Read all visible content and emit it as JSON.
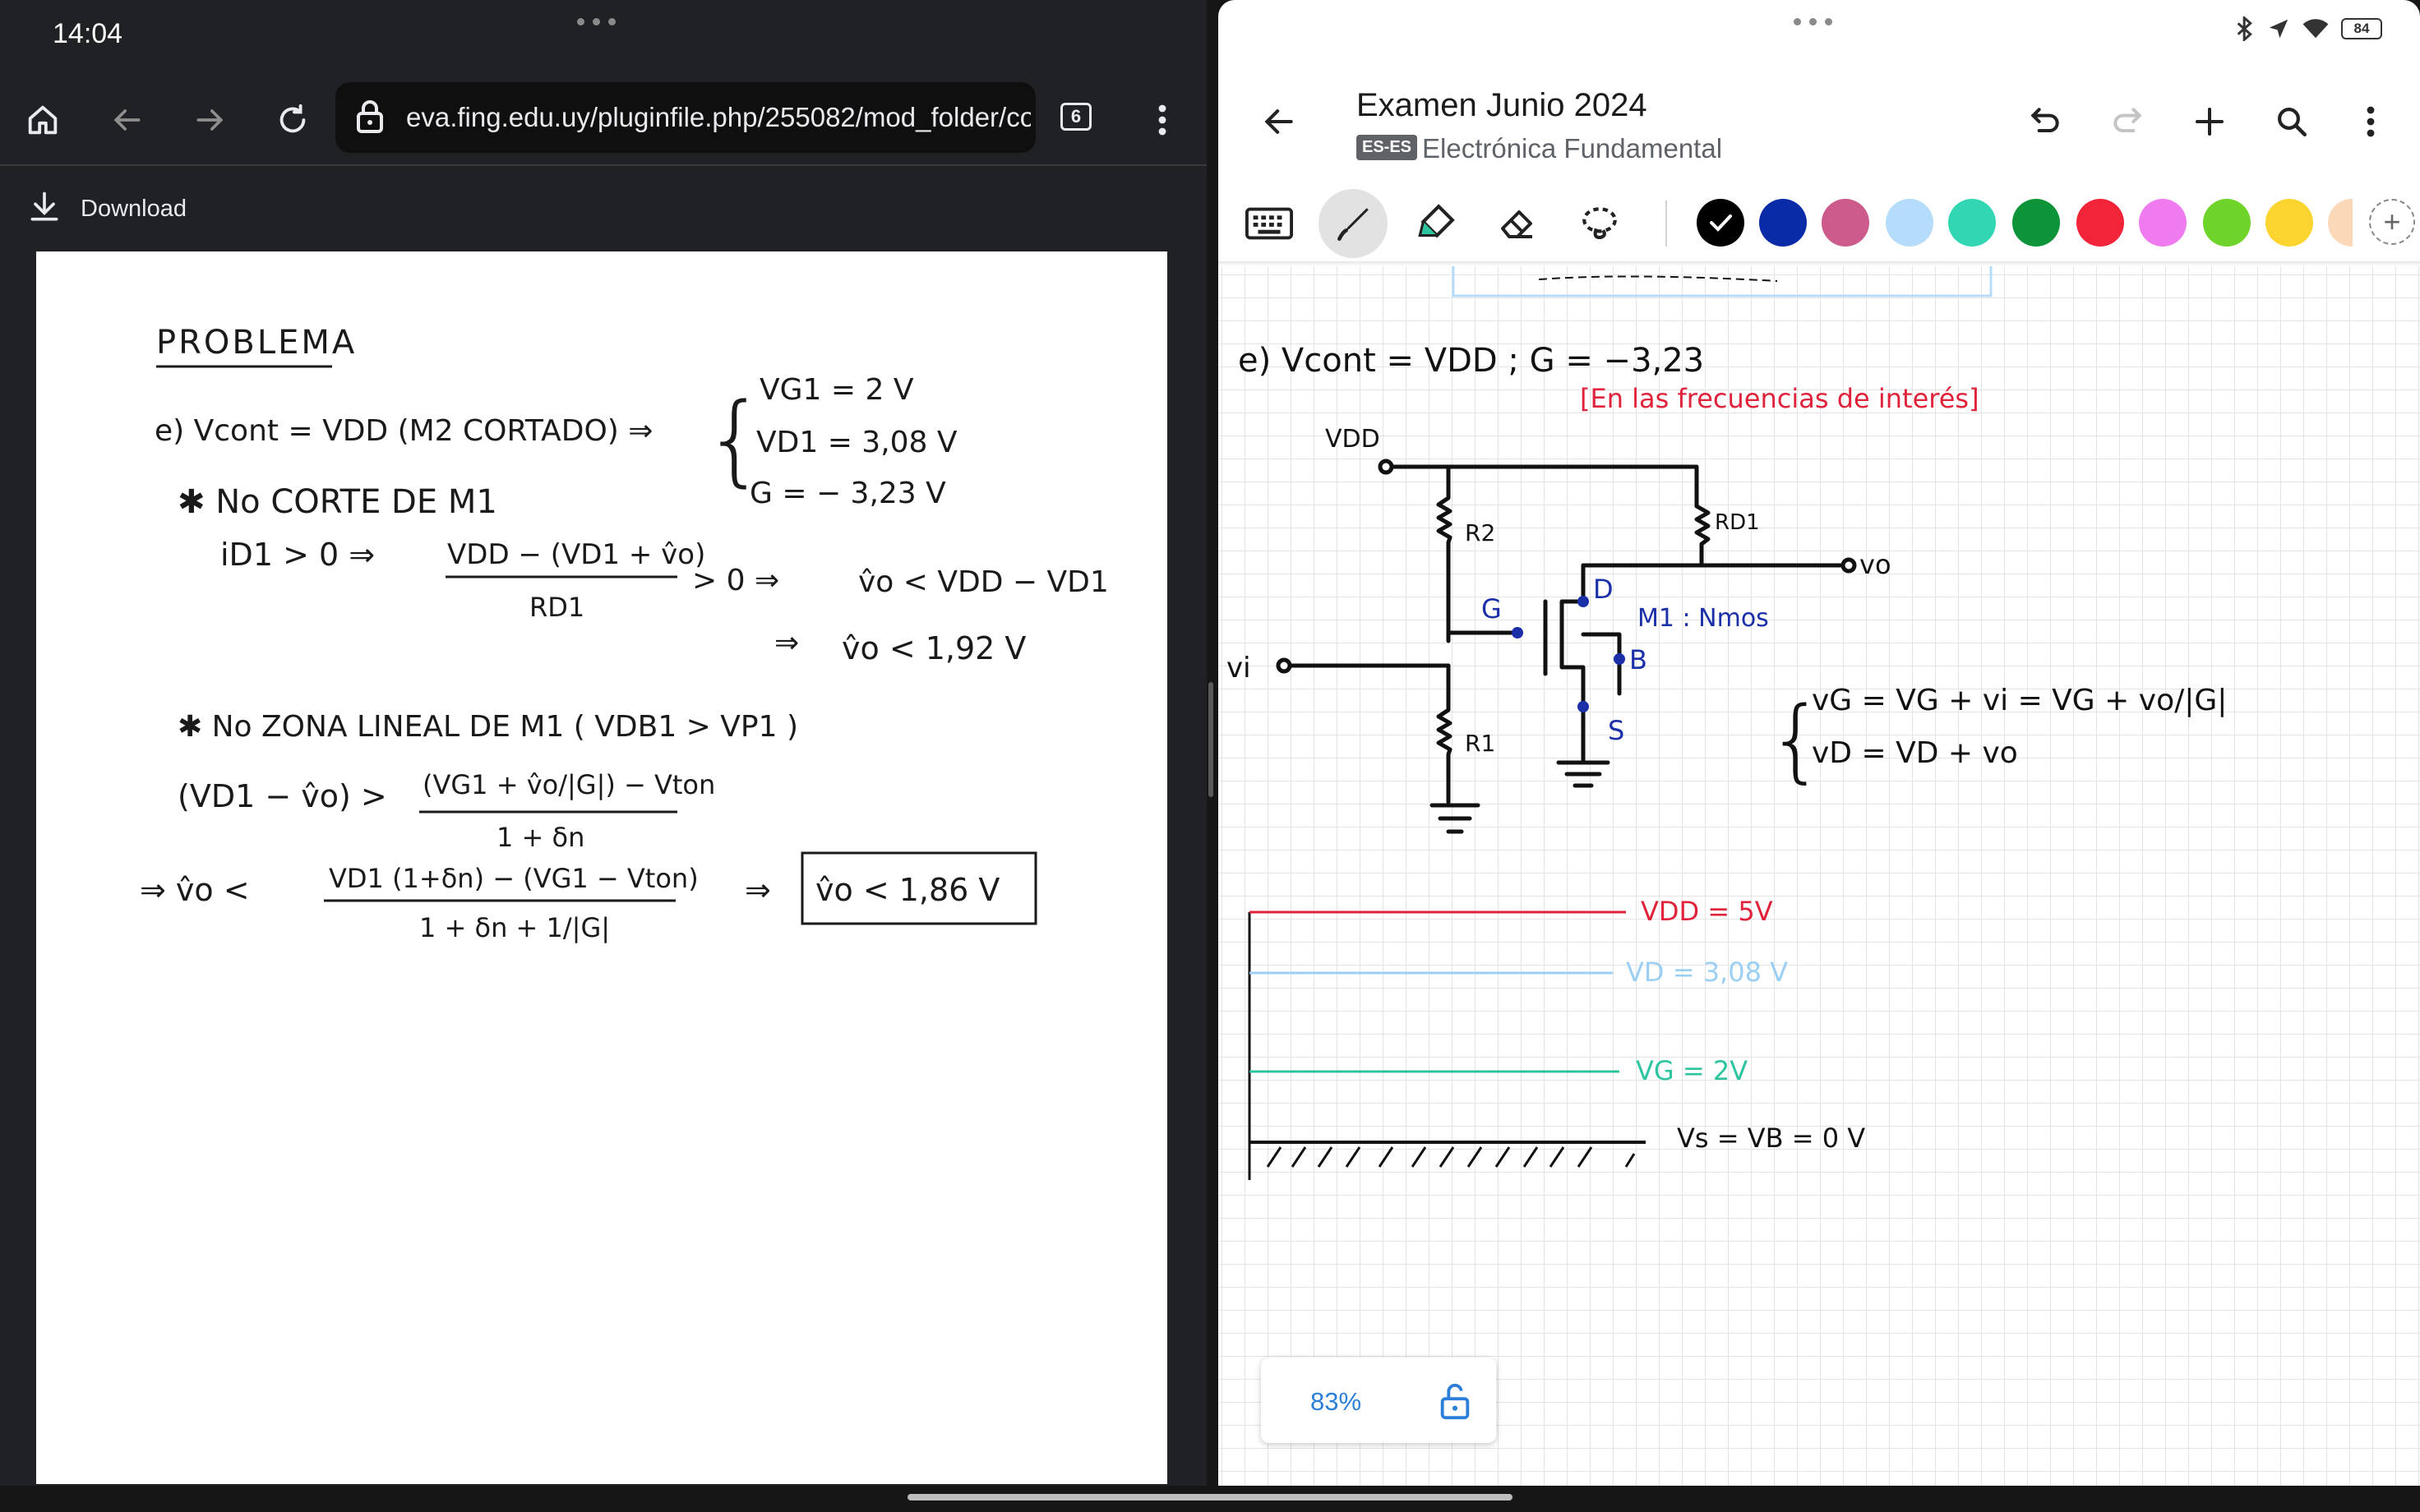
{
  "status_bar": {
    "time": "14:04",
    "battery": "84"
  },
  "browser": {
    "url": "eva.fing.edu.uy/pluginfile.php/255082/mod_folder/content",
    "tab_count": "6",
    "download_label": "Download"
  },
  "pdf": {
    "heading": "PROBLEMA",
    "line_e": "e)  Vcont = VDD  (M2 CORTADO)  ⇒",
    "brace_1": "VG1 = 2 V",
    "brace_2": "VD1 = 3,08 V",
    "brace_3": "G = − 3,23 V",
    "no_corte": "✱ No CORTE DE M1",
    "id1": "iD1 > 0  ⇒",
    "frac1_num": "VDD − (VD1 + v̂o)",
    "frac1_den": "RD1",
    "gt0": "> 0   ⇒",
    "res1": "v̂o < VDD − VD1",
    "res2_arrow": "⇒",
    "res2": "v̂o < 1,92 V",
    "no_lineal": "✱ No ZONA LINEAL DE M1  ( VDB1 > VP1 )",
    "lin_left": "(VD1 − v̂o) >",
    "frac2_num": "(VG1 + v̂o/|G|) − Vton",
    "frac2_den": "1 + δn",
    "final_arrow": "⇒  v̂o <",
    "frac3_num": "VD1 (1+δn) − (VG1 − Vton)",
    "frac3_den": "1 + δn + 1/|G|",
    "final_arrow2": "⇒",
    "boxed": "v̂o < 1,86 V"
  },
  "notes": {
    "title": "Examen Junio 2024",
    "lang_tag": "ES-ES",
    "subtitle": "Electrónica Fundamental",
    "zoom": "83%",
    "colors": [
      "#000000",
      "#0a2ba8",
      "#cc5a8a",
      "#b5dcfa",
      "#33d6b2",
      "#0d9438",
      "#f2243a",
      "#f07af0",
      "#6ed42a",
      "#fbd430"
    ],
    "ink": {
      "line_e": "e)  Vcont = VDD  ;  G = −3,23",
      "note_red": "[En las frecuencias de interés]",
      "vdd_label": "VDD",
      "rd1": "RD1",
      "r2": "R2",
      "r1": "R1",
      "vo": "vo",
      "vi": "vi",
      "g": "G",
      "d": "D",
      "s": "S",
      "b": "B",
      "m1": "M1 : Nmos",
      "eq1": "vG = VG + vi = VG + vo/|G|",
      "eq2": "vD = VD + vo",
      "lvl_vdd": "VDD = 5V",
      "lvl_vd": "VD = 3,08 V",
      "lvl_vg": "VG = 2V",
      "lvl_vs": "Vs = VB = 0 V"
    }
  }
}
